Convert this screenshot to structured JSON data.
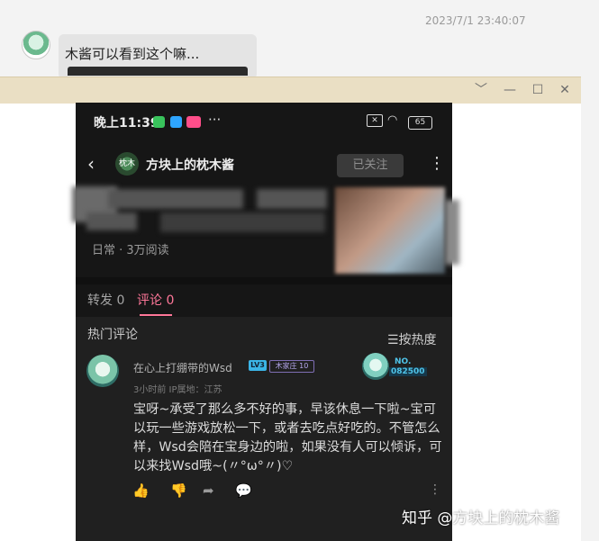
{
  "chat": {
    "timestamp": "2023/7/1 23:40:07",
    "message": "木酱可以看到这个嘛..."
  },
  "window": {
    "controls": {
      "dropdown": "﹀",
      "minimize": "—",
      "maximize": "☐",
      "close": "✕"
    }
  },
  "phone": {
    "status": {
      "time": "晚上11:39",
      "more": "···",
      "battery": "65",
      "wifi_icon": "wifi-icon",
      "sim_icon": "x-box"
    },
    "header": {
      "back": "‹",
      "avatar_text": "枕木",
      "author": "方块上的枕木酱",
      "follow": "已关注",
      "menu": "⋮"
    },
    "post_meta": "日常 · 3万阅读",
    "tabs": {
      "repost": "转发 0",
      "comment": "评论 0"
    },
    "comments": {
      "title": "热门评论",
      "sort": "☰按热度",
      "items": [
        {
          "user": "在心上打绷带的Wsd",
          "level": "LV3",
          "fan_badge": "木家庄 10",
          "badge_no": "NO.",
          "badge_num": "082500",
          "sub": "3小时前  IP属地：江苏",
          "text": "宝呀~承受了那么多不好的事，早该休息一下啦~宝可以玩一些游戏放松一下，或者去吃点好吃的。不管怎么样，Wsd会陪在宝身边的啦，如果没有人可以倾诉，可以来找Wsd哦~(〃°ω°〃)♡"
        }
      ],
      "actions": {
        "like": "👍",
        "dislike": "👎",
        "share": "➦",
        "reply": "💬",
        "more": "⋮"
      }
    }
  },
  "watermark": "知乎 @方块上的枕木酱",
  "colors": {
    "accent": "#ff7799",
    "window_bar": "#eadfc4",
    "phone_bg": "#161616"
  }
}
